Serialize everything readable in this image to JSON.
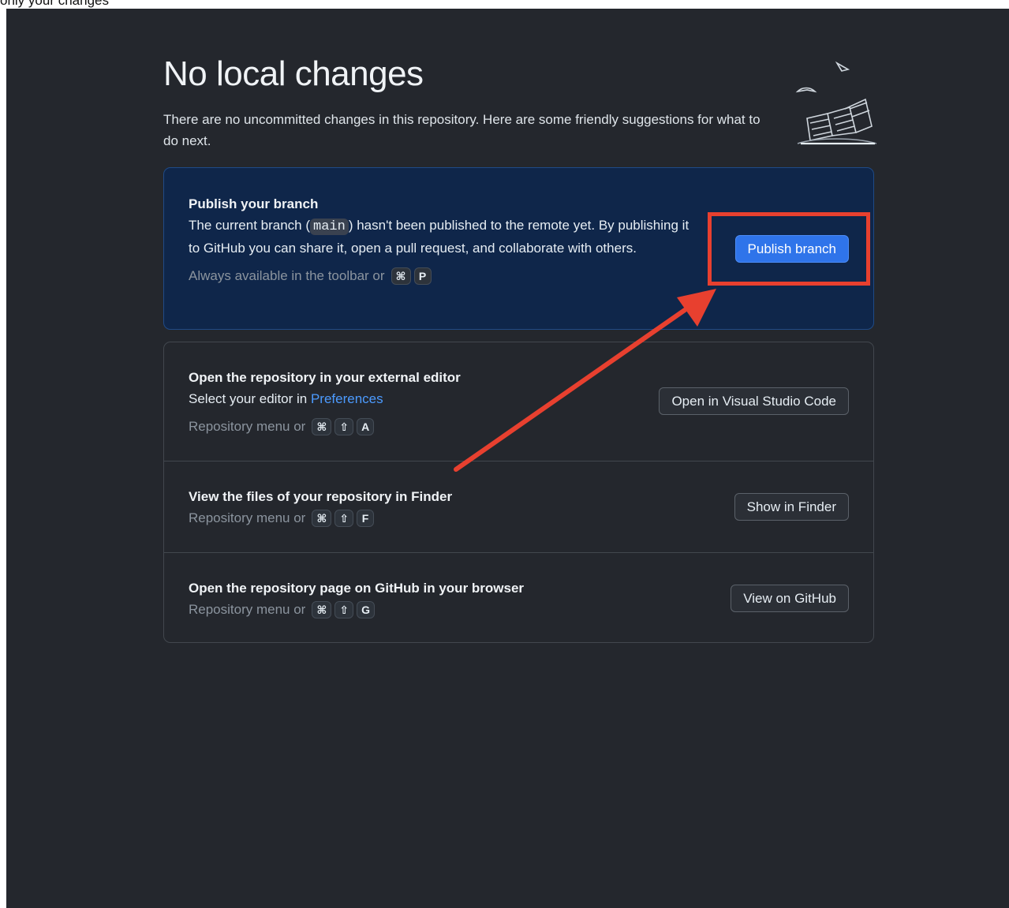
{
  "caption": "only your changes",
  "header": {
    "title": "No local changes",
    "subtitle": "There are no uncommitted changes in this repository. Here are some friendly suggestions for what to do next."
  },
  "publish": {
    "title": "Publish your branch",
    "desc_before": "The current branch (",
    "branch": "main",
    "desc_after": ") hasn't been published to the remote yet. By publishing it to GitHub you can share it, open a pull request, and collaborate with others.",
    "hint": "Always available in the toolbar or",
    "keys": [
      "⌘",
      "P"
    ],
    "button": "Publish branch"
  },
  "editor": {
    "title": "Open the repository in your external editor",
    "desc_before": "Select your editor in ",
    "link": "Preferences",
    "hint": "Repository menu or",
    "keys": [
      "⌘",
      "⇧",
      "A"
    ],
    "button": "Open in Visual Studio Code"
  },
  "finder": {
    "title": "View the files of your repository in Finder",
    "hint": "Repository menu or",
    "keys": [
      "⌘",
      "⇧",
      "F"
    ],
    "button": "Show in Finder"
  },
  "github": {
    "title": "Open the repository page on GitHub in your browser",
    "hint": "Repository menu or",
    "keys": [
      "⌘",
      "⇧",
      "G"
    ],
    "button": "View on GitHub"
  },
  "colors": {
    "background": "#24272d",
    "publish_card": "#0f264a",
    "accent": "#2f74ea",
    "annotation": "#e8402f"
  }
}
